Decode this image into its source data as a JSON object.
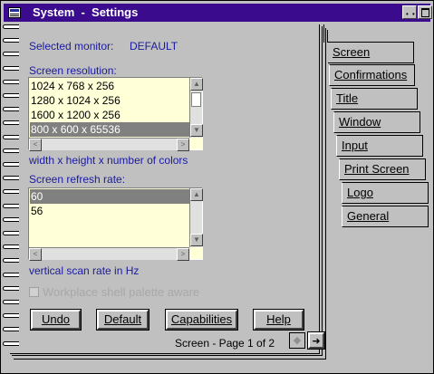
{
  "window": {
    "title": "System  -  Settings",
    "minmax_glyph": "• •"
  },
  "settings": {
    "selected_monitor_label": "Selected monitor:",
    "selected_monitor_value": "DEFAULT",
    "resolution_label": "Screen resolution:",
    "resolution_options": [
      "1024 x 768 x 256",
      "1280 x 1024 x 256",
      "1600 x 1200 x 256",
      "800 x 600 x 65536"
    ],
    "resolution_selected_index": 3,
    "resolution_hint": "width x height x number of colors",
    "refresh_label": "Screen refresh rate:",
    "refresh_options": [
      "60",
      "56"
    ],
    "refresh_selected_index": 0,
    "refresh_hint": "vertical scan rate in Hz",
    "checkbox_label": "Workplace shell palette aware",
    "checkbox_checked": false,
    "checkbox_enabled": false
  },
  "buttons": {
    "undo": "Undo",
    "default": "Default",
    "capabilities": "Capabilities",
    "help": "Help"
  },
  "pager": {
    "text": "Screen - Page 1 of 2",
    "prev_glyph": "◆",
    "next_glyph": "➜"
  },
  "tabs": [
    "Screen",
    "Confirmations",
    "Title",
    "Window",
    "Input",
    "Print Screen",
    "Logo",
    "General"
  ],
  "active_tab": "Screen",
  "scroll": {
    "up": "▲",
    "down": "▼",
    "left": "<",
    "right": ">"
  },
  "colors": {
    "titlebar": "#3a0b8c",
    "label_blue": "#1a1aa0",
    "listbox_bg": "#ffffd8",
    "selection": "#808080"
  }
}
